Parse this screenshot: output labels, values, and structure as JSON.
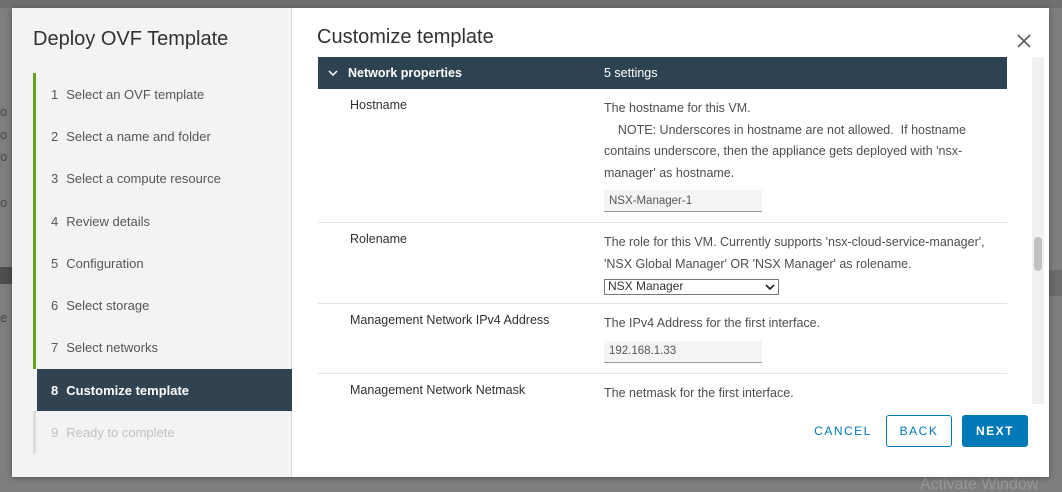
{
  "background": {
    "title_fragment": "...",
    "left_fragments": [
      "o",
      "o",
      "o",
      "o",
      "o",
      "e"
    ],
    "watermark": "Activate Window"
  },
  "wizard": {
    "title": "Deploy OVF Template",
    "steps": [
      {
        "num": "1",
        "label": "Select an OVF template",
        "state": "done"
      },
      {
        "num": "2",
        "label": "Select a name and folder",
        "state": "done"
      },
      {
        "num": "3",
        "label": "Select a compute resource",
        "state": "done"
      },
      {
        "num": "4",
        "label": "Review details",
        "state": "done"
      },
      {
        "num": "5",
        "label": "Configuration",
        "state": "done"
      },
      {
        "num": "6",
        "label": "Select storage",
        "state": "done"
      },
      {
        "num": "7",
        "label": "Select networks",
        "state": "done"
      },
      {
        "num": "8",
        "label": "Customize template",
        "state": "active"
      },
      {
        "num": "9",
        "label": "Ready to complete",
        "state": "pending"
      }
    ]
  },
  "content": {
    "title": "Customize template",
    "group": {
      "name": "Network properties",
      "count": "5 settings"
    },
    "properties": [
      {
        "name": "Hostname",
        "desc_lines": [
          "The hostname for this VM.",
          "    NOTE: Underscores in hostname are not allowed.  If hostname",
          "contains underscore, then the appliance gets deployed with 'nsx-",
          "manager' as hostname."
        ],
        "value": "NSX-Manager-1"
      },
      {
        "name": "Rolename",
        "desc_lines": [
          "The role for this VM. Currently supports 'nsx-cloud-service-manager',",
          "'NSX Global Manager' OR 'NSX Manager' as rolename."
        ],
        "selected": "NSX Manager"
      },
      {
        "name": "Management Network IPv4 Address",
        "desc_lines": [
          "The IPv4 Address for the first interface."
        ],
        "value": "192.168.1.33"
      },
      {
        "name": "Management Network Netmask",
        "desc_lines": [
          "The netmask for the first interface."
        ]
      }
    ]
  },
  "footer": {
    "cancel": "CANCEL",
    "back": "BACK",
    "next": "NEXT"
  },
  "colors": {
    "accent": "#0079b8",
    "progress_green": "#62a420",
    "header_dark": "#2e4352"
  }
}
